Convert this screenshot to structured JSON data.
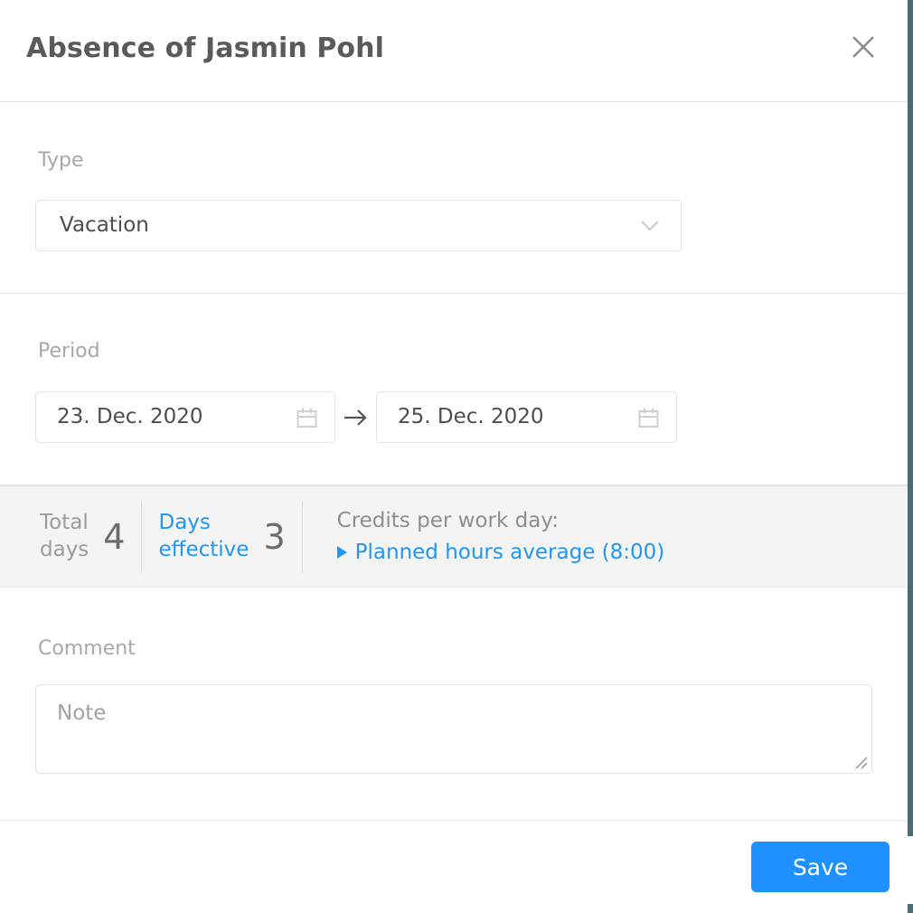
{
  "dialog": {
    "title": "Absence of Jasmin Pohl",
    "close_icon": "close-icon"
  },
  "type_section": {
    "label": "Type",
    "select": {
      "value": "Vacation",
      "chevron_icon": "chevron-down-icon"
    }
  },
  "period_section": {
    "label": "Period",
    "start_date": "23. Dec. 2020",
    "end_date": "25. Dec. 2020",
    "arrow_icon": "arrow-right-icon",
    "calendar_icon": "calendar-icon"
  },
  "summary": {
    "total_days_label_line1": "Total",
    "total_days_label_line2": "days",
    "total_days_value": "4",
    "days_effective_label_line1": "Days",
    "days_effective_label_line2": "effective",
    "days_effective_value": "3",
    "credits_title": "Credits per work day:",
    "credits_link": "Planned hours average (8:00)",
    "disclosure_icon": "triangle-right-icon"
  },
  "comment_section": {
    "label": "Comment",
    "placeholder": "Note",
    "value": "",
    "resize_icon": "resize-grip-icon"
  },
  "footer": {
    "save_label": "Save"
  },
  "colors": {
    "accent_blue": "#1e90ff",
    "link_blue": "#2196f3",
    "label_grey": "#a8a8a8",
    "text_dark": "#4d4d4d",
    "summary_bg": "#f4f4f4",
    "divider": "#e4e4e4",
    "scrollbar": "#4e6b75"
  }
}
